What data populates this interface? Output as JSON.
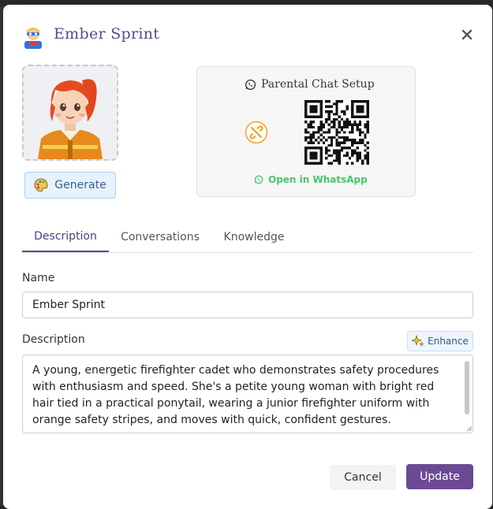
{
  "header": {
    "title": "Ember Sprint",
    "avatar_icon": "superhero-icon",
    "close_icon": "close-icon"
  },
  "avatar_panel": {
    "generate_label": "Generate",
    "generate_icon": "palette-icon"
  },
  "chat_setup": {
    "title": "Parental Chat Setup",
    "open_link": "Open in WhatsApp",
    "brand_color": "#4cc36a",
    "unlink_color": "#f0a020"
  },
  "tabs": [
    {
      "label": "Description",
      "active": true
    },
    {
      "label": "Conversations",
      "active": false
    },
    {
      "label": "Knowledge",
      "active": false
    }
  ],
  "form": {
    "name_label": "Name",
    "name_value": "Ember Sprint",
    "description_label": "Description",
    "enhance_label": "Enhance",
    "description_value": "A young, energetic firefighter cadet who demonstrates safety procedures with enthusiasm and speed. She's a petite young woman with bright red hair tied in a practical ponytail, wearing a junior firefighter uniform with orange safety stripes, and moves with quick, confident gestures."
  },
  "footer": {
    "cancel_label": "Cancel",
    "update_label": "Update"
  },
  "colors": {
    "accent": "#6b4a96",
    "title": "#5b4a8c"
  }
}
